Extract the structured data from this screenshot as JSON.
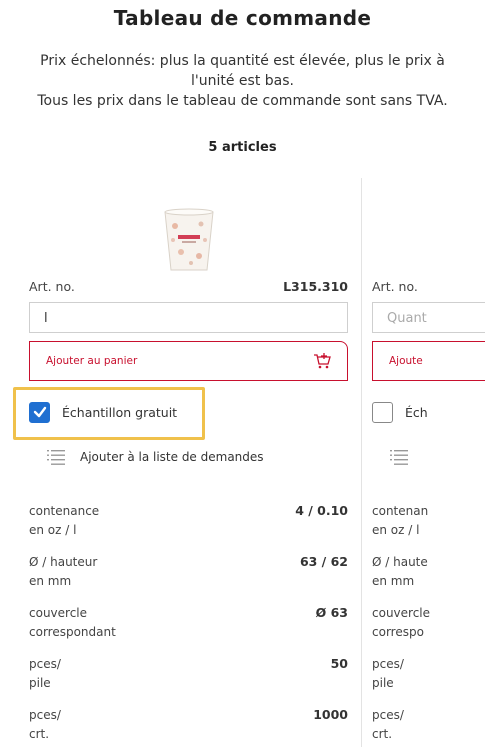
{
  "header": {
    "title": "Tableau de commande",
    "intro_line1": "Prix échelonnés: plus la quantité est élevée, plus le prix à l'unité est bas.",
    "intro_line2": "Tous les prix dans le tableau de commande sont sans TVA.",
    "article_count": "5 articles"
  },
  "columns": [
    {
      "art_no_label": "Art. no.",
      "art_no": "L315.310",
      "quantity_value": "l",
      "add_to_cart": "Ajouter au panier",
      "free_sample_label": "Échantillon gratuit",
      "free_sample_checked": true,
      "add_to_requests": "Ajouter à la liste de demandes",
      "specs": [
        {
          "label_line1": "contenance",
          "label_line2": "en oz / l",
          "value": "4 / 0.10"
        },
        {
          "label_line1": "Ø / hauteur",
          "label_line2": "en mm",
          "value": "63 / 62"
        },
        {
          "label_line1": "couvercle",
          "label_line2": "correspondant",
          "value": "Ø 63"
        },
        {
          "label_line1": "pces/",
          "label_line2": "pile",
          "value": "50"
        },
        {
          "label_line1": "pces/",
          "label_line2": "crt.",
          "value": "1000"
        }
      ]
    },
    {
      "art_no_label": "Art. no.",
      "quantity_placeholder": "Quant",
      "add_to_cart": "Ajoute",
      "free_sample_label": "Éch",
      "free_sample_checked": false,
      "specs": [
        {
          "label_line1": "contenan",
          "label_line2": "en oz / l"
        },
        {
          "label_line1": "Ø / haute",
          "label_line2": "en mm"
        },
        {
          "label_line1": "couvercle",
          "label_line2": "correspo"
        },
        {
          "label_line1": "pces/",
          "label_line2": "pile"
        },
        {
          "label_line1": "pces/",
          "label_line2": "crt."
        }
      ]
    }
  ],
  "colors": {
    "accent_red": "#c8102e",
    "checkbox_blue": "#1f6fd1",
    "highlight_yellow": "#f0c14b"
  },
  "icons": [
    "product-cup-image",
    "cart-plus-icon",
    "checkmark-icon",
    "list-icon"
  ]
}
